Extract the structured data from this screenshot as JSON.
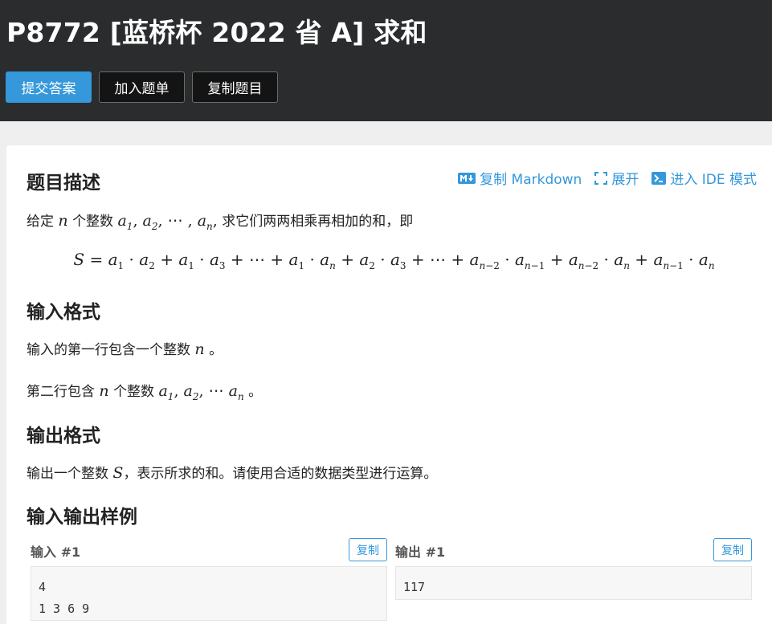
{
  "header": {
    "title": "P8772 [蓝桥杯 2022 省 A] 求和",
    "buttons": {
      "submit": "提交答案",
      "add_to_list": "加入题单",
      "copy_problem": "复制题目"
    }
  },
  "toolbar": {
    "copy_markdown": "复制 Markdown",
    "expand": "展开",
    "ide_mode": "进入 IDE 模式"
  },
  "sections": {
    "description": {
      "heading": "题目描述",
      "text_prefix": "给定",
      "text_mid": "个整数",
      "text_suffix": "求它们两两相乘再相加的和，即"
    },
    "input_format": {
      "heading": "输入格式",
      "line1_prefix": "输入的第一行包含一个整数",
      "line1_suffix": "。",
      "line2_prefix": "第二行包含",
      "line2_mid": "个整数",
      "line2_suffix": "。"
    },
    "output_format": {
      "heading": "输出格式",
      "line_prefix": "输出一个整数",
      "line_suffix": "，表示所求的和。请使用合适的数据类型进行运算。"
    },
    "samples": {
      "heading": "输入输出样例",
      "input_label": "输入 #1",
      "output_label": "输出 #1",
      "copy_label": "复制",
      "input_value": "4\n1 3 6 9",
      "output_value": "117"
    }
  },
  "colors": {
    "header_bg": "#2b2c2e",
    "accent": "#3498db",
    "page_bg": "#efefef"
  },
  "icons": [
    "markdown-icon",
    "expand-icon",
    "terminal-icon"
  ]
}
